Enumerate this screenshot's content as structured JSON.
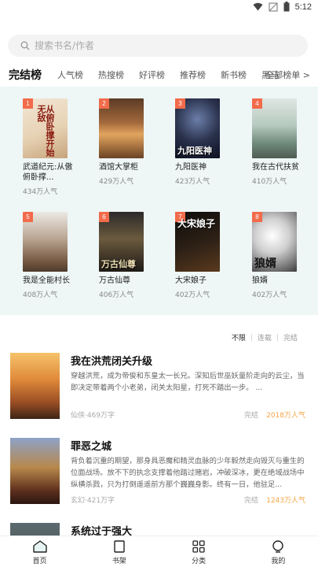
{
  "status_bar": {
    "time": "5:12",
    "icons": [
      "wifi-icon",
      "signal-off-icon",
      "battery-icon"
    ]
  },
  "search": {
    "placeholder": "搜索书名/作者"
  },
  "tabs": [
    {
      "label": "完结榜",
      "active": true
    },
    {
      "label": "人气榜"
    },
    {
      "label": "热搜榜"
    },
    {
      "label": "好评榜"
    },
    {
      "label": "推荐榜"
    },
    {
      "label": "新书榜"
    },
    {
      "label": "黑马"
    }
  ],
  "tabs_more": "全部榜单 >",
  "ranking": [
    {
      "rank": "1",
      "name": "武道纪元:从傲俯卧撑...",
      "popularity": "434万人气",
      "cover_text": "从俯卧撑开始无敌"
    },
    {
      "rank": "2",
      "name": "酒馆大掌柜",
      "popularity": "429万人气",
      "cover_text": ""
    },
    {
      "rank": "3",
      "name": "九阳医神",
      "popularity": "423万人气",
      "cover_text": "九阳医神"
    },
    {
      "rank": "4",
      "name": "我在古代扶贫",
      "popularity": "410万人气",
      "cover_text": ""
    },
    {
      "rank": "5",
      "name": "我是全能村长",
      "popularity": "408万人气",
      "cover_text": ""
    },
    {
      "rank": "6",
      "name": "万古仙尊",
      "popularity": "406万人气",
      "cover_text": "万古仙尊"
    },
    {
      "rank": "7",
      "name": "大宋娘子",
      "popularity": "402万人气",
      "cover_text": "大宋娘子"
    },
    {
      "rank": "8",
      "name": "狼婿",
      "popularity": "402万人气",
      "cover_text": "狼婿"
    }
  ],
  "filter": {
    "options": [
      "不限",
      "连载",
      "完结"
    ],
    "active": "不限"
  },
  "list": [
    {
      "title": "我在洪荒闭关升级",
      "desc": "穿越洪荒，成为帝俊和东皇太一长兄。深知后世巫妖量阶走向的云尘，当即决定带着两个小老弟，闭关太阳星，打死不踏出一步。 ...",
      "meta": "仙侠·469万字",
      "status": "完结",
      "hot": "2018万人气"
    },
    {
      "title": "罪恶之城",
      "desc": "背负着沉重的期望，那身具恶魔和精灵血脉的少年毅然走向毁灭与重生的位面战场。放不下的执念支撑着他踏过赌岩，冲破深冰，更在绝域战场中纵横杀戮，只为打倒遥遥前方那个巍巍身影。终有一日，他驻足...",
      "meta": "玄幻·421万字",
      "status": "完结",
      "hot": "1243万人气"
    },
    {
      "title": "系统过于强大",
      "desc": "",
      "meta": "",
      "status": "",
      "hot": ""
    }
  ],
  "bottom_nav": [
    {
      "label": "首页",
      "icon": "home-icon",
      "active": true
    },
    {
      "label": "书架",
      "icon": "bookshelf-icon"
    },
    {
      "label": "分类",
      "icon": "category-icon"
    },
    {
      "label": "我的",
      "icon": "profile-icon"
    }
  ],
  "colors": {
    "accent": "#f5a646",
    "badge": "#f26b4b",
    "panel_bg": "#eef6f6"
  }
}
